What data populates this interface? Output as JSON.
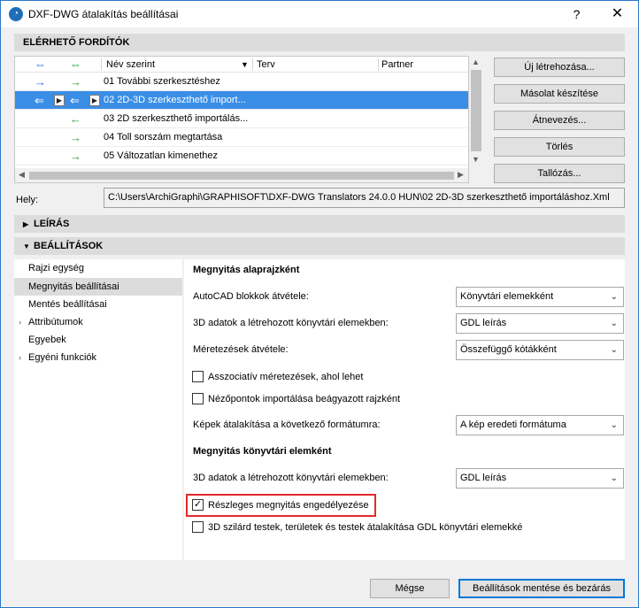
{
  "window": {
    "title": "DXF-DWG átalakítás beállításai",
    "help": "?",
    "close": "✕"
  },
  "translators_section": {
    "header": "ELÉRHETŐ FORDÍTÓK",
    "columns": [
      "Név szerint",
      "Terv",
      "Partner"
    ],
    "rows": [
      {
        "name": "01 További szerkesztéshez"
      },
      {
        "name": "02 2D-3D szerkeszthető import..."
      },
      {
        "name": "03 2D szerkeszthető importálás..."
      },
      {
        "name": "04 Toll sorszám megtartása"
      },
      {
        "name": "05 Változatlan kimenethez"
      }
    ],
    "buttons": {
      "new": "Új létrehozása...",
      "copy": "Másolat készítése",
      "rename": "Átnevezés...",
      "delete": "Törlés",
      "browse": "Tallózás..."
    }
  },
  "location": {
    "label": "Hely:",
    "path": "C:\\Users\\ArchiGraphi\\GRAPHISOFT\\DXF-DWG Translators 24.0.0 HUN\\02 2D-3D szerkeszthető importáláshoz.Xml"
  },
  "description_section": {
    "header": "LEÍRÁS"
  },
  "settings_section": {
    "header": "BEÁLLÍTÁSOK",
    "nav": [
      "Rajzi egység",
      "Megnyitás beállításai",
      "Mentés beállításai",
      "Attribútumok",
      "Egyebek",
      "Egyéni funkciók"
    ],
    "panel": {
      "title_plan": "Megnyitás alaprajzként",
      "autocad_blocks_label": "AutoCAD blokkok átvétele:",
      "autocad_blocks_value": "Könyvtári elemekként",
      "data3d_label": "3D adatok a létrehozott könyvtári elemekben:",
      "data3d_value": "GDL leírás",
      "dimensions_label": "Méretezések átvétele:",
      "dimensions_value": "Összefüggő kótákként",
      "assoc_dims": "Asszociatív méretezések, ahol lehet",
      "viewpoints": "Nézőpontok importálása beágyazott rajzként",
      "images_label": "Képek átalakítása a következő formátumra:",
      "images_value": "A kép eredeti formátuma",
      "title_library": "Megnyitás könyvtári elemként",
      "lib_data3d_label": "3D adatok a létrehozott könyvtári elemekben:",
      "lib_data3d_value": "GDL leírás",
      "partial_open": "Részleges megnyitás engedélyezése",
      "solids_convert": "3D szilárd testek, területek és testek átalakítása GDL könyvtári elemekké"
    }
  },
  "footer": {
    "cancel": "Mégse",
    "save_close": "Beállítások mentése és bezárás"
  },
  "colors": {
    "selection": "#3a8ee6",
    "highlight": "#e02b2b",
    "arrow_blue": "#2b78e4",
    "arrow_green": "#1fa34a"
  }
}
